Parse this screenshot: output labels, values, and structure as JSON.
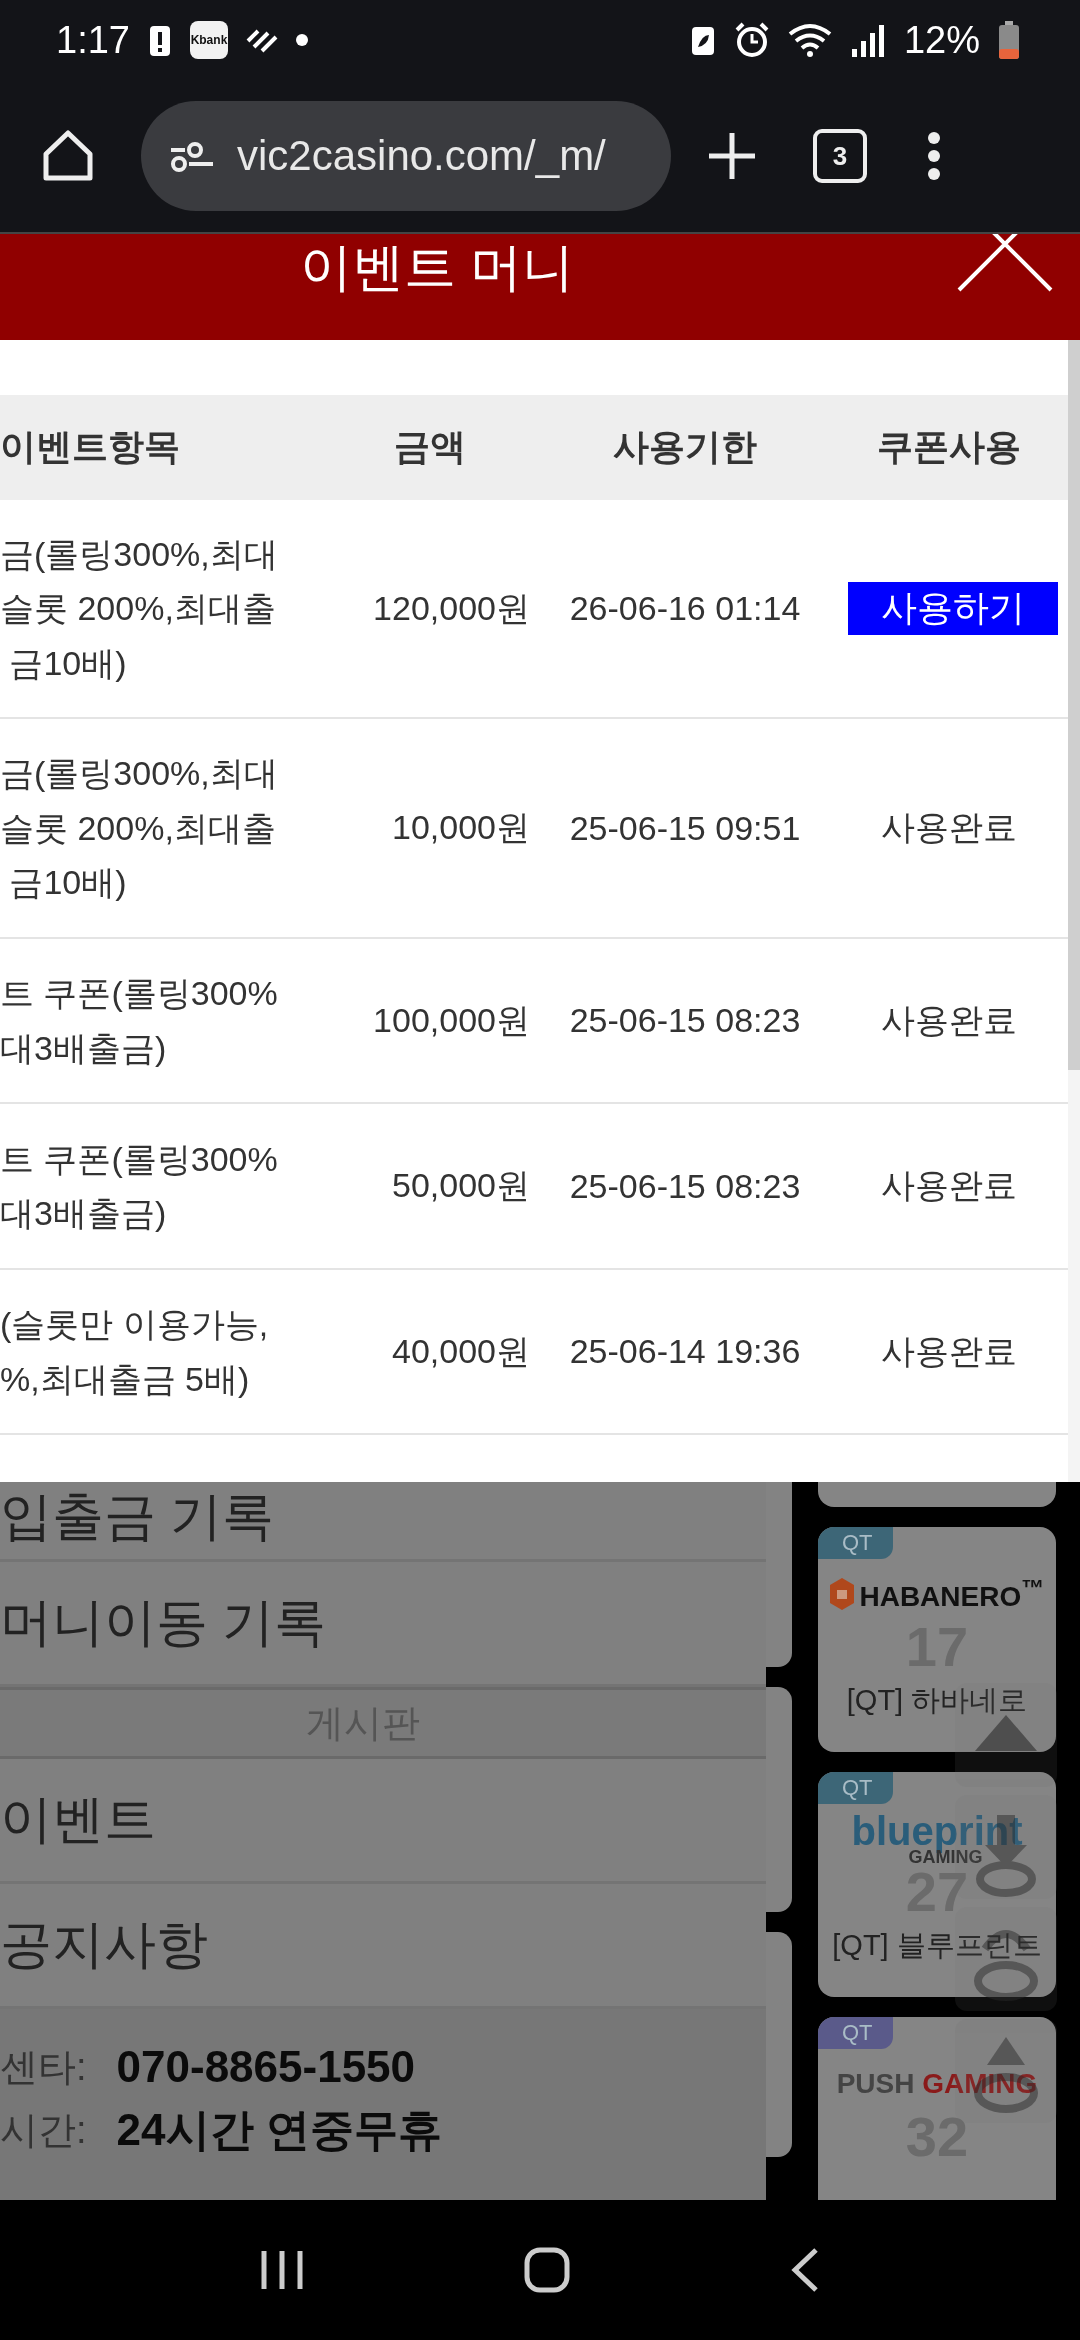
{
  "status_bar": {
    "time": "1:17",
    "bank_badge": "Kbank",
    "battery": "12%"
  },
  "browser": {
    "url": "vic2casino.com/_m/",
    "tab_count": "3"
  },
  "modal": {
    "title": "이벤트 머니",
    "columns": [
      "이벤트항목",
      "금액",
      "사용기한",
      "쿠폰사용"
    ],
    "rows": [
      {
        "event": "금(롤링300%,최대\n슬롯 200%,최대출\n 금10배)",
        "amount": "120,000원",
        "expires": "26-06-16 01:14",
        "coupon": "사용하기",
        "kind": "button"
      },
      {
        "event": "금(롤링300%,최대\n슬롯 200%,최대출\n 금10배)",
        "amount": "10,000원",
        "expires": "25-06-15 09:51",
        "coupon": "사용완료",
        "kind": "done"
      },
      {
        "event": "트 쿠폰(롤링300%\n대3배출금)",
        "amount": "100,000원",
        "expires": "25-06-15 08:23",
        "coupon": "사용완료",
        "kind": "done"
      },
      {
        "event": "트 쿠폰(롤링300%\n대3배출금)",
        "amount": "50,000원",
        "expires": "25-06-15 08:23",
        "coupon": "사용완료",
        "kind": "done"
      },
      {
        "event": "(슬롯만 이용가능,\n%,최대출금 5배)",
        "amount": "40,000원",
        "expires": "25-06-14 19:36",
        "coupon": "사용완료",
        "kind": "done"
      }
    ]
  },
  "menu": [
    {
      "label": "입출금 기록",
      "kind": "item"
    },
    {
      "label": "머니이동 기록",
      "kind": "item"
    },
    {
      "label": "게시판",
      "kind": "section"
    },
    {
      "label": "이벤트",
      "kind": "item"
    },
    {
      "label": "공지사항",
      "kind": "item"
    }
  ],
  "contact": [
    {
      "label": "센타:",
      "value": "070-8865-1550"
    },
    {
      "label": "시간:",
      "value": "24시간 연중무휴"
    }
  ],
  "games": {
    "cards": [
      {
        "badge": "QT",
        "logo": "HABANERO",
        "logo_sub": "™",
        "kind": "habanero",
        "number": "17",
        "name": "[QT] 하바네로"
      },
      {
        "badge": "QT",
        "logo": "blueprint",
        "logo_sub": "GAMING",
        "kind": "blueprint",
        "number": "27",
        "name": "[QT] 블루프린트"
      },
      {
        "badge": "QT",
        "logo": "PUSH",
        "logo_sub": "GAMING",
        "kind": "push",
        "number": "32"
      }
    ]
  }
}
